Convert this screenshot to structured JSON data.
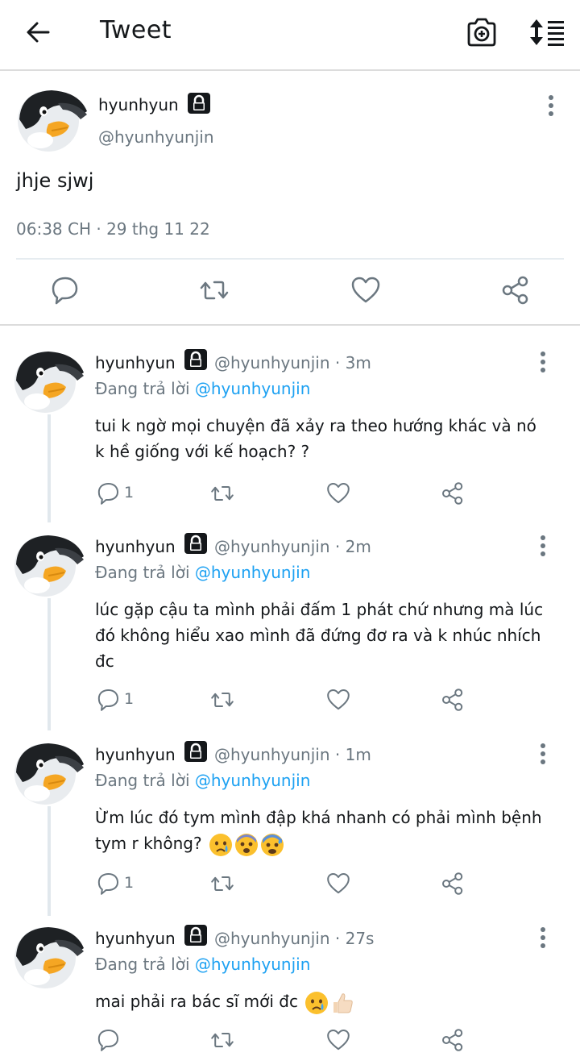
{
  "header": {
    "title": "Tweet",
    "back_icon": "arrow-left-icon",
    "camera_icon": "camera-add-icon",
    "sort_icon": "sort-icon"
  },
  "colors": {
    "mention": "#1da1f2",
    "secondary_text": "#6b7780",
    "primary_text": "#14171a"
  },
  "tweet": {
    "name": "hyunhyun",
    "handle": "@hyunhyunjin",
    "text": "jhje sjwj",
    "timestamp": "06:38 CH · 29 thg 11 22"
  },
  "replies": [
    {
      "name": "hyunhyun",
      "meta": "@hyunhyunjin · 3m",
      "replying_prefix": "Đang trả lời ",
      "replying_to": "@hyunhyunjin",
      "text": "tui k ngờ mọi chuyện đã xảy ra theo hướng khác và nó k hề giống với kế hoạch? ?",
      "reply_count": "1",
      "emojis": []
    },
    {
      "name": "hyunhyun",
      "meta": "@hyunhyunjin · 2m",
      "replying_prefix": "Đang trả lời ",
      "replying_to": "@hyunhyunjin",
      "text": "lúc gặp cậu ta mình phải đấm 1 phát chứ nhưng mà lúc đó không hiểu xao mình đã đứng đơ ra và k nhúc nhích đc",
      "reply_count": "1",
      "emojis": []
    },
    {
      "name": "hyunhyun",
      "meta": "@hyunhyunjin · 1m",
      "replying_prefix": "Đang trả lời ",
      "replying_to": "@hyunhyunjin",
      "text": "Ừm lúc đó tym mình đập khá nhanh có phải mình bệnh tym r không?",
      "reply_count": "1",
      "emojis": [
        "crying-face",
        "fearful-face",
        "anxious-sweat-face"
      ]
    },
    {
      "name": "hyunhyun",
      "meta": "@hyunhyunjin · 27s",
      "replying_prefix": "Đang trả lời ",
      "replying_to": "@hyunhyunjin",
      "text": "mai phải ra bác sĩ mới đc",
      "reply_count": "",
      "emojis": [
        "crying-face",
        "thumbs-up"
      ]
    }
  ]
}
